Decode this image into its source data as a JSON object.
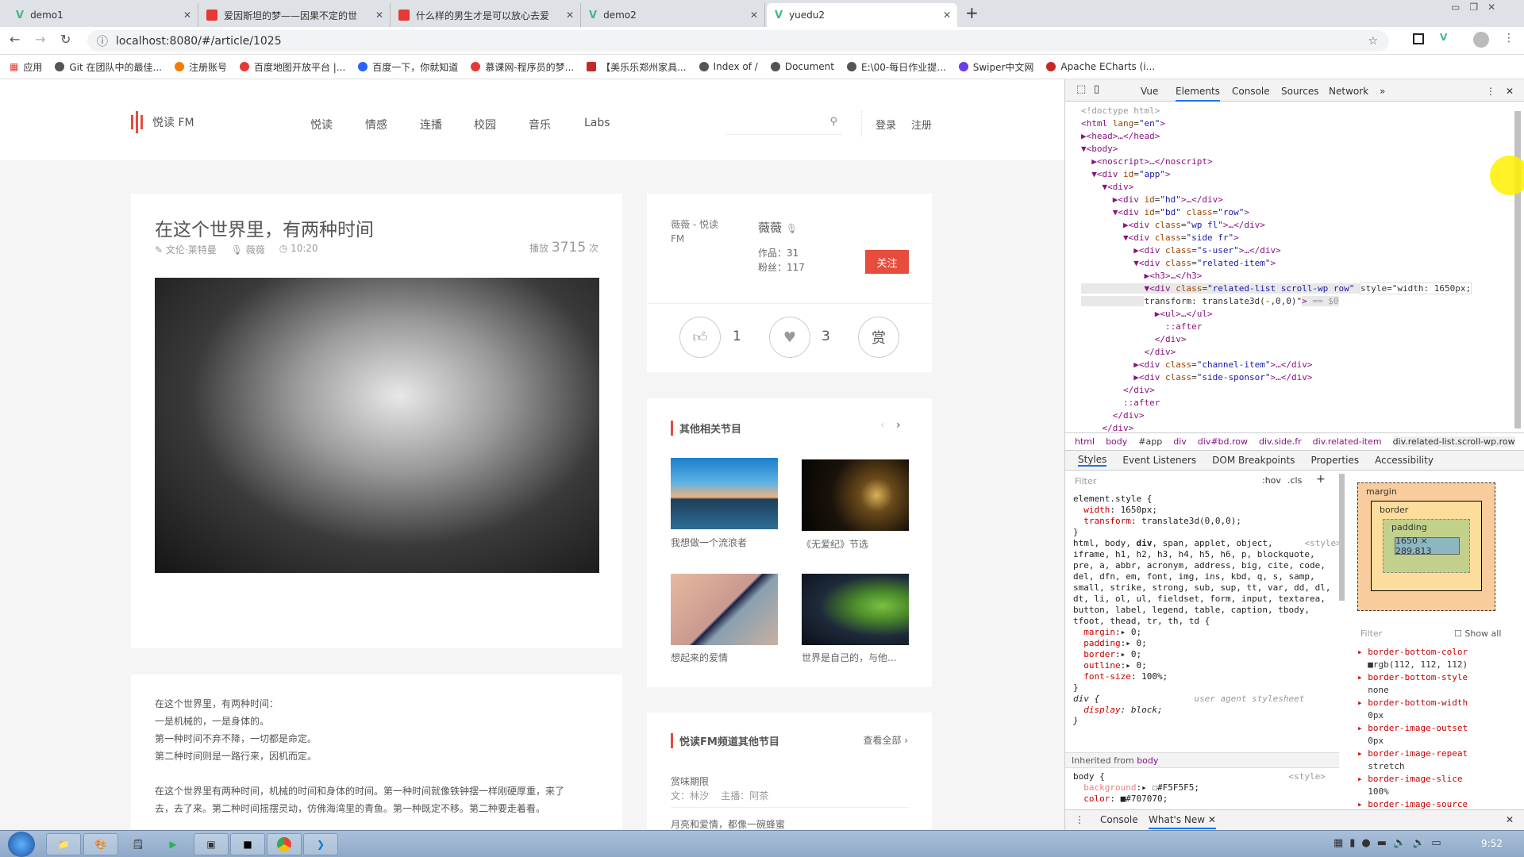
{
  "browser": {
    "tabs": [
      {
        "title": "demo1",
        "icon": "vue-icon"
      },
      {
        "title": "爱因斯坦的梦——因果不定的世",
        "icon": "yuedu-icon"
      },
      {
        "title": "什么样的男生才是可以放心去爱",
        "icon": "yuedu-icon"
      },
      {
        "title": "demo2",
        "icon": "vue-icon"
      },
      {
        "title": "yuedu2",
        "icon": "vue-icon",
        "active": true
      }
    ],
    "url": "localhost:8080/#/article/1025",
    "bookmarks": [
      "应用",
      "Git 在团队中的最佳...",
      "注册账号",
      "百度地图开放平台 |...",
      "百度一下，你就知道",
      "慕课网-程序员的梦...",
      "【美乐乐郑州家具...",
      "Index of /",
      "Document",
      "E:\\00-每日作业提...",
      "Swiper中文网",
      "Apache ECharts (i..."
    ]
  },
  "site": {
    "logo": "悦读 FM",
    "brand_color": "#e74c3c",
    "nav": [
      "悦读",
      "情感",
      "连播",
      "校园",
      "音乐",
      "Labs"
    ],
    "login": "登录",
    "register": "注册"
  },
  "article": {
    "title": "在这个世界里，有两种时间",
    "author": "文伦·莱特曼",
    "anchor": "薇薇",
    "duration": "10:20",
    "plays_prefix": "播放",
    "plays": "3715",
    "plays_suffix": "次",
    "body": [
      "在这个世界里，有两种时间：",
      "一是机械的，一是身体的。",
      "第一种时间不弃不降，一切都是命定。",
      "第二种时间则是一路行来，因机而定。"
    ],
    "paragraph": [
      "在这个世界里有两种时间，机械的时间和身体的时间。第一种时间就像铁钟摆一样刚硬厚重，来了",
      "去，去了来。第二种时间摇摆灵动，仿佛海湾里的青鱼。第一种既定不移。第二种要走着看。"
    ]
  },
  "user": {
    "avatar_alt": "薇薇 - 悦读 FM",
    "name": "薇薇",
    "works": "作品：31",
    "fans": "粉丝：117",
    "follow": "关注",
    "likes": "1",
    "favorites": "3",
    "reward": "赏"
  },
  "related": {
    "title": "其他相关节目",
    "items": [
      {
        "title": "我想做一个流浪者"
      },
      {
        "title": "《无爱纪》节选"
      },
      {
        "title": "想起来的爱情"
      },
      {
        "title": "世界是自己的，与他..."
      }
    ]
  },
  "channel": {
    "title": "悦读FM频道其他节目",
    "more": "查看全部 ›",
    "items": [
      {
        "title": "赏味期限",
        "author": "文：林汐",
        "anchor": "主播：阿茶"
      },
      {
        "title": "月亮和爱情，都像一碗蜂蜜"
      }
    ]
  },
  "devtools": {
    "tabs": [
      "Vue",
      "Elements",
      "Console",
      "Sources",
      "Network",
      "»"
    ],
    "active_tab": "Elements",
    "breadcrumb": [
      "html",
      "body",
      "#app",
      "div",
      "div#bd.row",
      "div.side.fr",
      "div.related-item",
      "div.related-list.scroll-wp.row"
    ],
    "sub_tabs": [
      "Styles",
      "Event Listeners",
      "DOM Breakpoints",
      "Properties",
      "Accessibility"
    ],
    "filter_placeholder": "Filter",
    "hov": ":hov",
    "cls": ".cls",
    "box_model": {
      "margin": "margin",
      "border": "border",
      "padding": "padding",
      "content": "1650 × 289.813",
      "dash": "–"
    },
    "computed_filter": "Filter",
    "show_all": "Show all",
    "computed": [
      {
        "p": "border-bottom-color",
        "v": "rgb(112, 112, 112)"
      },
      {
        "p": "border-bottom-style",
        "v": "none"
      },
      {
        "p": "border-bottom-width",
        "v": "0px"
      },
      {
        "p": "border-image-outset",
        "v": "0px"
      },
      {
        "p": "border-image-repeat",
        "v": "stretch"
      },
      {
        "p": "border-image-slice",
        "v": "100%"
      },
      {
        "p": "border-image-source",
        "v": ""
      }
    ],
    "inherited_label": "Inherited from",
    "inherited_from": "body",
    "drawer_tabs": [
      "Console",
      "What's New"
    ]
  },
  "taskbar": {
    "clock": "9:52"
  }
}
